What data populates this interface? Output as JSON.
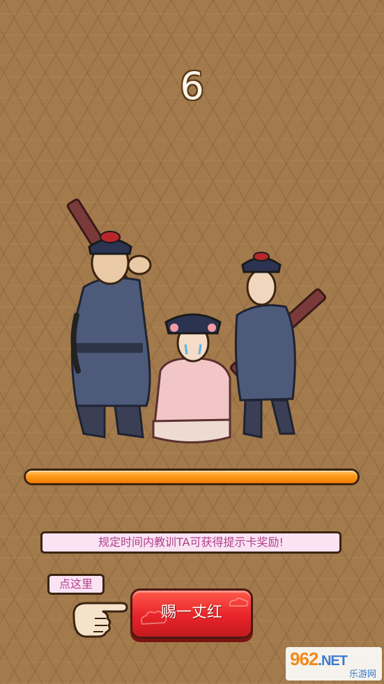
{
  "game": {
    "countdown": "6",
    "progress_percent": 100,
    "tip_text": "规定时间内教训TA可获得提示卡奖励!",
    "click_here_label": "点这里",
    "action_button_label": "赐一丈红"
  },
  "watermark": {
    "logo_main": "962",
    "logo_suffix": ".NET",
    "site_name": "乐游网"
  },
  "colors": {
    "background": "#a37a4c",
    "progress_fill": "#ff9a1a",
    "button_red": "#e8242a",
    "tip_text": "#b0408a"
  }
}
